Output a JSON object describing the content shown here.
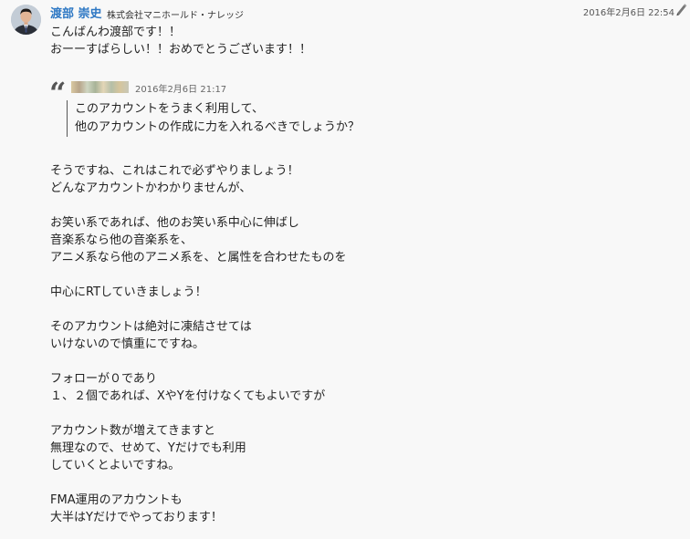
{
  "author": {
    "name": "渡部 崇史",
    "company": "株式会社マニホールド・ナレッジ"
  },
  "timestamp": "2016年2月6日 22:54",
  "greeting_lines": [
    "こんばんわ渡部です！！",
    "おーーすばらしい！！おめでとうございます！！"
  ],
  "quote": {
    "date": "2016年2月6日 21:17",
    "lines": [
      "このアカウントをうまく利用して、",
      "他のアカウントの作成に力を入れるべきでしょうか？"
    ]
  },
  "body_lines": [
    "そうですね、これはこれで必ずやりましょう！",
    "どんなアカウントかわかりませんが、",
    "",
    "お笑い系であれば、他のお笑い系中心に伸ばし",
    "音楽系なら他の音楽系を、",
    "アニメ系なら他のアニメ系を、と属性を合わせたものを",
    "",
    "中心にRTしていきましょう！",
    "",
    "そのアカウントは絶対に凍結させては",
    "いけないので慎重にですね。",
    "",
    "フォローが０であり",
    "１、２個であれば、XやYを付けなくてもよいですが",
    "",
    "アカウント数が増えてきますと",
    "無理なので、せめて、Yだけでも利用",
    "していくとよいですね。",
    "",
    "FMA運用のアカウントも",
    "大半はYだけでやっております！"
  ],
  "icons": {
    "avatar": "avatar-photo",
    "edit": "pencil-icon",
    "quote": "quote-mark-icon"
  },
  "colors": {
    "author_name": "#2e78c4",
    "background": "#f8f8f8",
    "text": "#222222"
  }
}
